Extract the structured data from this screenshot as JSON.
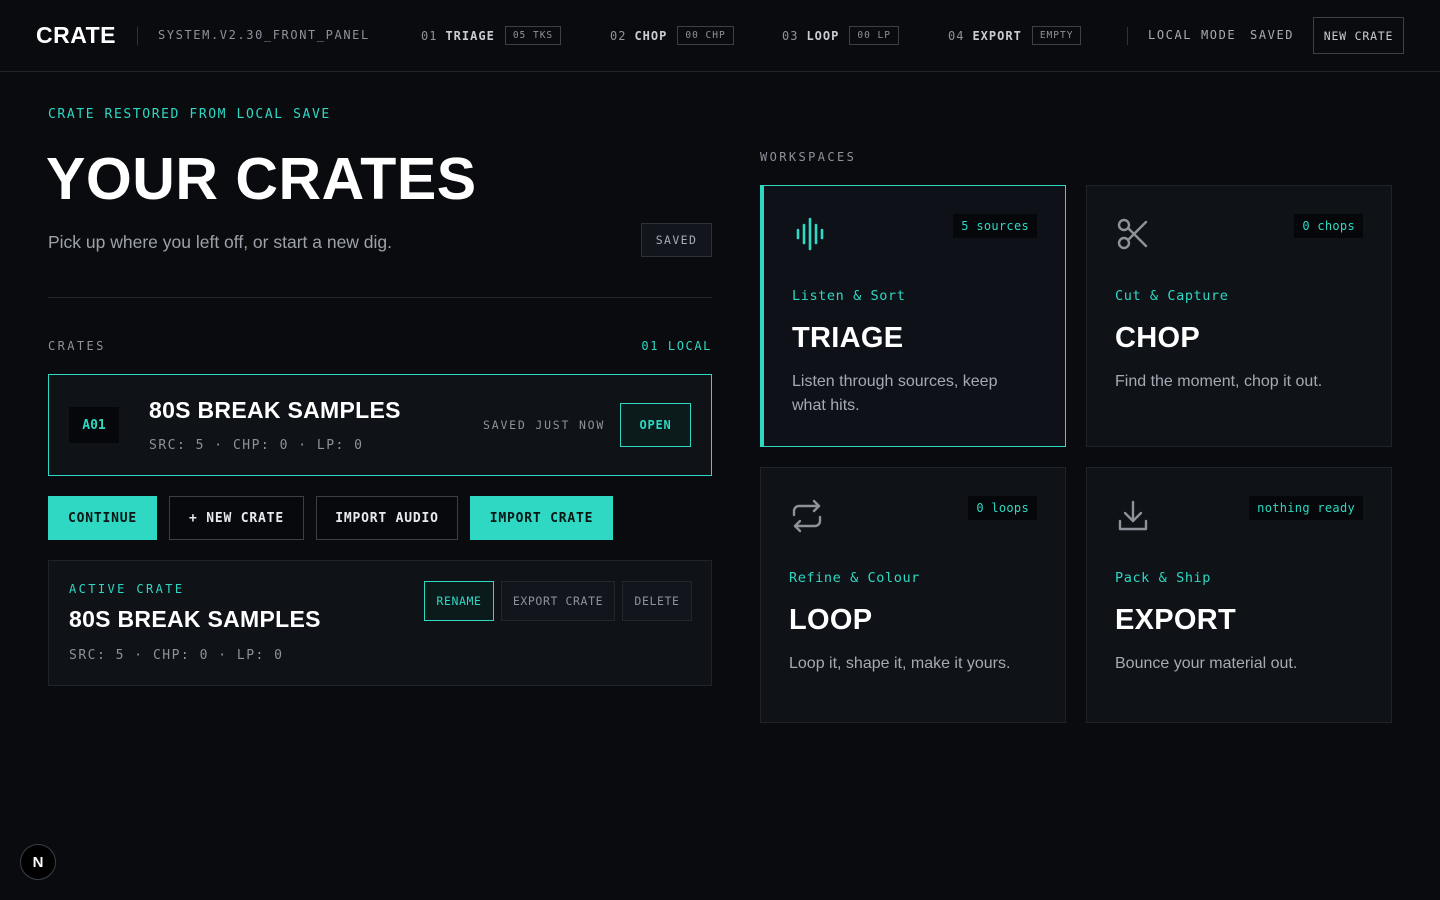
{
  "header": {
    "logo": "CRATE",
    "system": "SYSTEM.V2.30_FRONT_PANEL",
    "steps": [
      {
        "num": "01",
        "label": "TRIAGE",
        "tag": "05 TKS"
      },
      {
        "num": "02",
        "label": "CHOP",
        "tag": "00 CHP"
      },
      {
        "num": "03",
        "label": "LOOP",
        "tag": "00 LP"
      },
      {
        "num": "04",
        "label": "EXPORT",
        "tag": "EMPTY"
      }
    ],
    "mode": "LOCAL MODE",
    "status": "SAVED",
    "new_crate": "NEW CRATE"
  },
  "hero": {
    "restored": "CRATE RESTORED FROM LOCAL SAVE",
    "title": "YOUR CRATES",
    "subtitle": "Pick up where you left off, or start a new dig.",
    "saved_pill": "SAVED"
  },
  "crates": {
    "label": "CRATES",
    "count": "01 LOCAL",
    "items": [
      {
        "id": "A01",
        "name": "80S BREAK SAMPLES",
        "stats": "SRC: 5 · CHP: 0 · LP: 0",
        "saved": "SAVED JUST NOW",
        "open": "OPEN"
      }
    ]
  },
  "actions": {
    "continue": "CONTINUE",
    "new_crate": "+ NEW CRATE",
    "import_audio": "IMPORT AUDIO",
    "import_crate": "IMPORT CRATE"
  },
  "active": {
    "label": "ACTIVE CRATE",
    "name": "80S BREAK SAMPLES",
    "stats": "SRC: 5 · CHP: 0 · LP: 0",
    "rename": "RENAME",
    "export": "EXPORT CRATE",
    "delete": "DELETE"
  },
  "workspaces": {
    "label": "WORKSPACES",
    "cards": [
      {
        "icon": "waveform-icon",
        "badge": "5 sources",
        "kicker": "Listen & Sort",
        "title": "TRIAGE",
        "desc": "Listen through sources, keep what hits."
      },
      {
        "icon": "scissors-icon",
        "badge": "0 chops",
        "kicker": "Cut & Capture",
        "title": "CHOP",
        "desc": "Find the moment, chop it out."
      },
      {
        "icon": "repeat-icon",
        "badge": "0 loops",
        "kicker": "Refine & Colour",
        "title": "LOOP",
        "desc": "Loop it, shape it, make it yours."
      },
      {
        "icon": "download-icon",
        "badge": "nothing ready",
        "kicker": "Pack & Ship",
        "title": "EXPORT",
        "desc": "Bounce your material out."
      }
    ]
  },
  "dev_badge": "N",
  "colors": {
    "accent": "#2ed8c3",
    "background": "#0a0b0e",
    "card": "#0f1217"
  }
}
